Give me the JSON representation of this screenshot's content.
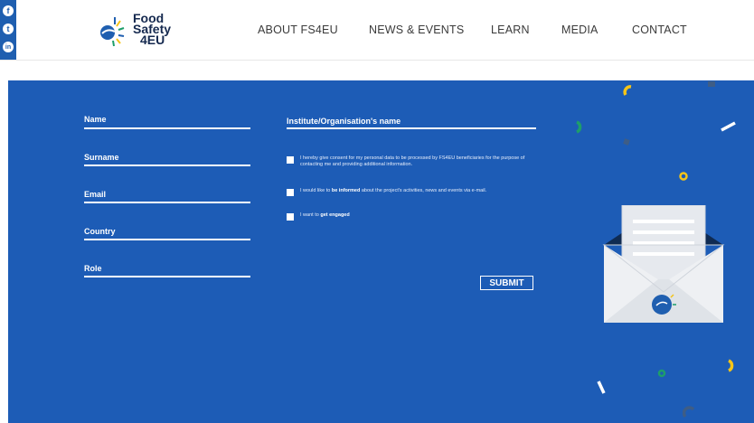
{
  "social": {
    "facebook_glyph": "f",
    "twitter_glyph": "t",
    "linkedin_glyph": "in"
  },
  "logo": {
    "line1": "Food",
    "line2": "Safety",
    "line3": "4EU"
  },
  "nav": {
    "items": [
      {
        "label": "ABOUT FS4EU"
      },
      {
        "label": "NEWS & EVENTS"
      },
      {
        "label": "LEARN"
      },
      {
        "label": "MEDIA"
      },
      {
        "label": "CONTACT"
      }
    ]
  },
  "form": {
    "fields": {
      "name": "Name",
      "surname": "Surname",
      "email": "Email",
      "country": "Country",
      "role": "Role",
      "institute": "Institute/Organisation's name"
    },
    "consent": {
      "text1": "I hereby give consent for my personal data to be processed by FS4EU beneficiaries for the purpose of contacting me and providing additional information.",
      "text2a": "I would like to ",
      "text2b": "be informed",
      "text2c": " about the project's activities, news and events via e-mail.",
      "text3a": "I want to ",
      "text3b": "get engaged"
    },
    "submit": "SUBMIT"
  },
  "colors": {
    "panel": "#1d5cb6",
    "accent_yellow": "#f5c518",
    "accent_green": "#1e9e6a",
    "navy": "#15294f"
  }
}
